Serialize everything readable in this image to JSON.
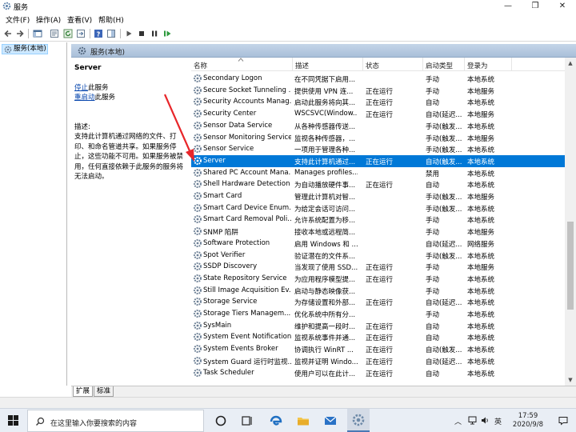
{
  "window": {
    "title": "服务",
    "minimize": "—",
    "restore": "❐",
    "close": "✕"
  },
  "menu": {
    "items": [
      "文件(F)",
      "操作(A)",
      "查看(V)",
      "帮助(H)"
    ]
  },
  "tree": {
    "root_label": "服务(本地)"
  },
  "pane_header": {
    "title": "服务(本地)"
  },
  "details": {
    "service_name": "Server",
    "stop_link": "停止",
    "stop_suffix": "此服务",
    "restart_link": "重启动",
    "restart_suffix": "此服务",
    "desc_label": "描述:",
    "desc_text": "支持此计算机通过网络的文件、打印、和命名管道共享。如果服务停止，这些功能不可用。如果服务被禁用，任何直接依赖于此服务的服务将无法启动。"
  },
  "columns": [
    "名称",
    "描述",
    "状态",
    "启动类型",
    "登录为"
  ],
  "services": [
    {
      "name": "Secondary Logon",
      "desc": "在不同凭据下启用...",
      "status": "",
      "startup": "手动",
      "logon": "本地系统"
    },
    {
      "name": "Secure Socket Tunneling ...",
      "desc": "提供使用 VPN 连...",
      "status": "正在运行",
      "startup": "手动",
      "logon": "本地服务"
    },
    {
      "name": "Security Accounts Manag...",
      "desc": "启动此服务将向其...",
      "status": "正在运行",
      "startup": "自动",
      "logon": "本地系统"
    },
    {
      "name": "Security Center",
      "desc": "WSCSVC(Window...",
      "status": "正在运行",
      "startup": "自动(延迟...",
      "logon": "本地服务"
    },
    {
      "name": "Sensor Data Service",
      "desc": "从各种传感器传送...",
      "status": "",
      "startup": "手动(触发...",
      "logon": "本地系统"
    },
    {
      "name": "Sensor Monitoring Service",
      "desc": "监视各种传感器，...",
      "status": "",
      "startup": "手动(触发...",
      "logon": "本地服务"
    },
    {
      "name": "Sensor Service",
      "desc": "一项用于管理各种...",
      "status": "",
      "startup": "手动(触发...",
      "logon": "本地系统"
    },
    {
      "name": "Server",
      "desc": "支持此计算机通过...",
      "status": "正在运行",
      "startup": "自动(触发...",
      "logon": "本地系统",
      "selected": true
    },
    {
      "name": "Shared PC Account Mana...",
      "desc": "Manages profiles...",
      "status": "",
      "startup": "禁用",
      "logon": "本地系统"
    },
    {
      "name": "Shell Hardware Detection",
      "desc": "为自动播放硬件事...",
      "status": "正在运行",
      "startup": "自动",
      "logon": "本地系统"
    },
    {
      "name": "Smart Card",
      "desc": "管理此计算机对智...",
      "status": "",
      "startup": "手动(触发...",
      "logon": "本地服务"
    },
    {
      "name": "Smart Card Device Enum...",
      "desc": "为给定会话可访问...",
      "status": "",
      "startup": "手动(触发...",
      "logon": "本地系统"
    },
    {
      "name": "Smart Card Removal Poli...",
      "desc": "允许系统配置为移...",
      "status": "",
      "startup": "手动",
      "logon": "本地系统"
    },
    {
      "name": "SNMP 陷阱",
      "desc": "接收本地或远程简...",
      "status": "",
      "startup": "手动",
      "logon": "本地服务"
    },
    {
      "name": "Software Protection",
      "desc": "启用 Windows 和 ...",
      "status": "",
      "startup": "自动(延迟...",
      "logon": "网络服务"
    },
    {
      "name": "Spot Verifier",
      "desc": "验证潜在的文件系...",
      "status": "",
      "startup": "手动(触发...",
      "logon": "本地系统"
    },
    {
      "name": "SSDP Discovery",
      "desc": "当发现了使用 SSD...",
      "status": "正在运行",
      "startup": "手动",
      "logon": "本地服务"
    },
    {
      "name": "State Repository Service",
      "desc": "为应用程序模型提...",
      "status": "正在运行",
      "startup": "手动",
      "logon": "本地系统"
    },
    {
      "name": "Still Image Acquisition Ev...",
      "desc": "启动与静态映像获...",
      "status": "",
      "startup": "手动",
      "logon": "本地系统"
    },
    {
      "name": "Storage Service",
      "desc": "为存储设置和外部...",
      "status": "正在运行",
      "startup": "自动(延迟...",
      "logon": "本地系统"
    },
    {
      "name": "Storage Tiers Managem...",
      "desc": "优化系统中所有分...",
      "status": "",
      "startup": "手动",
      "logon": "本地系统"
    },
    {
      "name": "SysMain",
      "desc": "维护和提高一段时...",
      "status": "正在运行",
      "startup": "自动",
      "logon": "本地系统"
    },
    {
      "name": "System Event Notification...",
      "desc": "监视系统事件并通...",
      "status": "正在运行",
      "startup": "自动",
      "logon": "本地系统"
    },
    {
      "name": "System Events Broker",
      "desc": "协调执行 WinRT ...",
      "status": "正在运行",
      "startup": "自动(触发...",
      "logon": "本地系统"
    },
    {
      "name": "System Guard 运行时监视...",
      "desc": "监视并证明 Windo...",
      "status": "正在运行",
      "startup": "自动(延迟...",
      "logon": "本地系统"
    },
    {
      "name": "Task Scheduler",
      "desc": "使用户可以在此计...",
      "status": "正在运行",
      "startup": "自动",
      "logon": "本地系统"
    }
  ],
  "tabs": [
    "扩展",
    "标准"
  ],
  "taskbar": {
    "search_placeholder": "在这里输入你要搜索的内容",
    "ime": "英",
    "time": "17:59",
    "date": "2020/9/8"
  },
  "colors": {
    "selection": "#0078d7",
    "header": "#b7c9e0",
    "annotation_arrow": "#e8262a"
  }
}
